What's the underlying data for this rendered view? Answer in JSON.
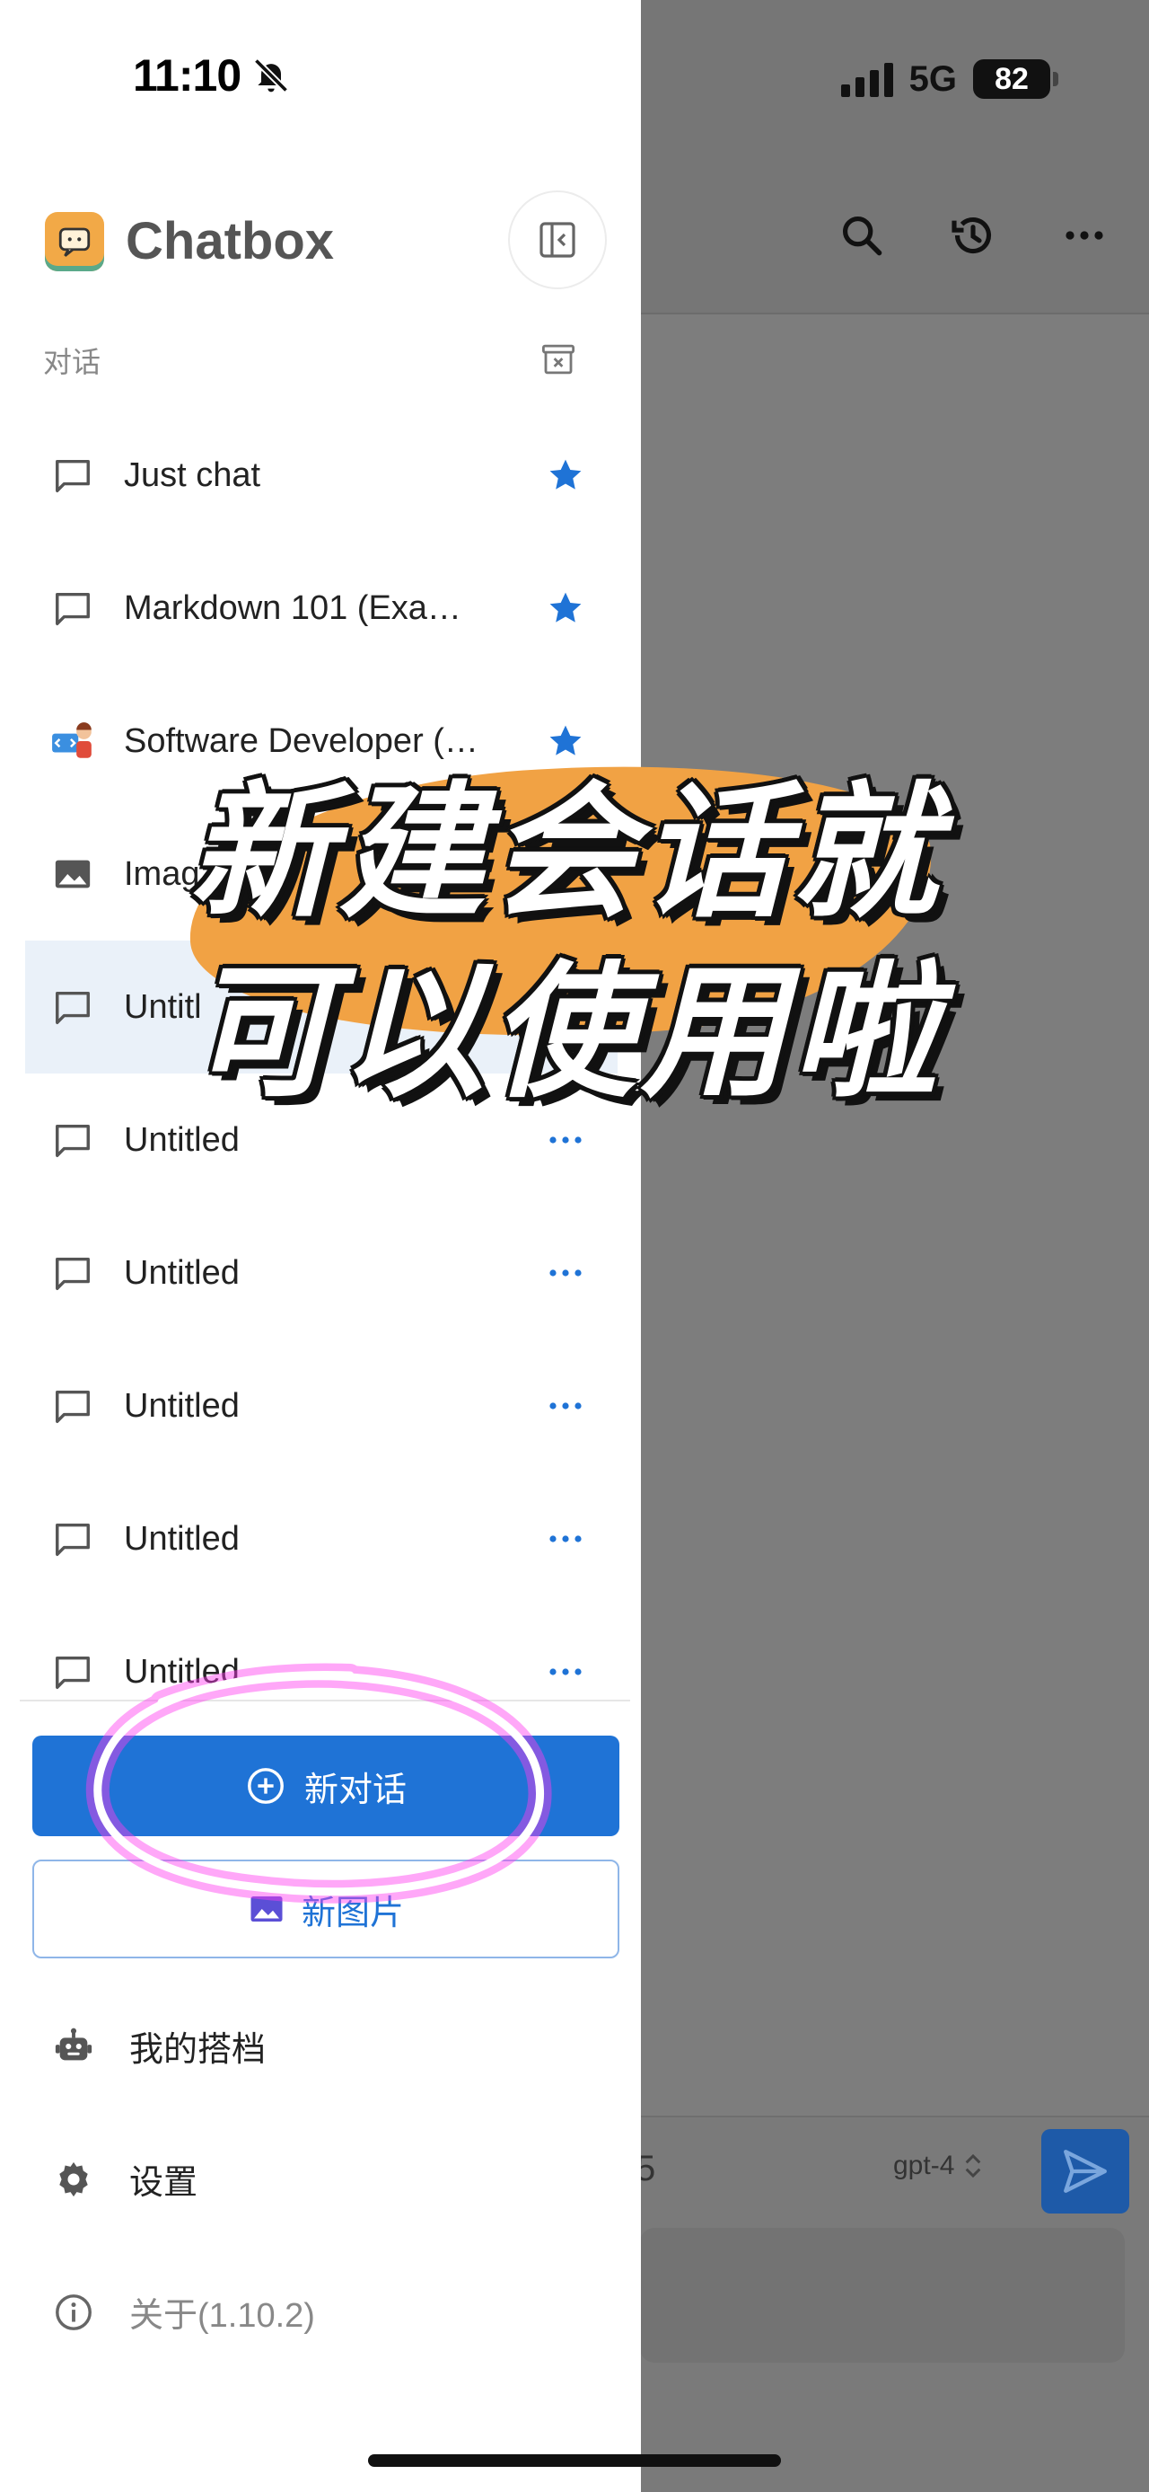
{
  "status_bar": {
    "time": "11:10",
    "network": "5G",
    "battery": "82"
  },
  "app": {
    "name": "Chatbox"
  },
  "sidebar": {
    "section_title": "对话",
    "conversations": [
      {
        "label": "Just chat",
        "icon": "chat-bubble-icon",
        "marker": "star"
      },
      {
        "label": "Markdown 101 (Exa…",
        "icon": "chat-bubble-icon",
        "marker": "star"
      },
      {
        "label": "Software Developer (…",
        "icon": "developer-avatar",
        "marker": "star"
      },
      {
        "label": "Imag",
        "icon": "image-icon",
        "marker": "none"
      },
      {
        "label": "Untitl",
        "icon": "chat-bubble-icon",
        "marker": "none",
        "active": true
      },
      {
        "label": "Untitled",
        "icon": "chat-bubble-icon",
        "marker": "more"
      },
      {
        "label": "Untitled",
        "icon": "chat-bubble-icon",
        "marker": "more"
      },
      {
        "label": "Untitled",
        "icon": "chat-bubble-icon",
        "marker": "more"
      },
      {
        "label": "Untitled",
        "icon": "chat-bubble-icon",
        "marker": "more"
      },
      {
        "label": "Untitled",
        "icon": "chat-bubble-icon",
        "marker": "more"
      }
    ],
    "new_chat_label": "新对话",
    "new_image_label": "新图片",
    "menu": {
      "copilots": "我的搭档",
      "settings": "设置",
      "about": "关于(1.10.2)"
    }
  },
  "background": {
    "model_name": "gpt-4",
    "partial_text": "5"
  },
  "overlay": {
    "line1": "新建会话就",
    "line2": "可以使用啦"
  },
  "colors": {
    "accent": "#1f73d6",
    "star": "#1f73d6",
    "highlight": "#f1a244",
    "scribble": "#ff3cf0"
  }
}
